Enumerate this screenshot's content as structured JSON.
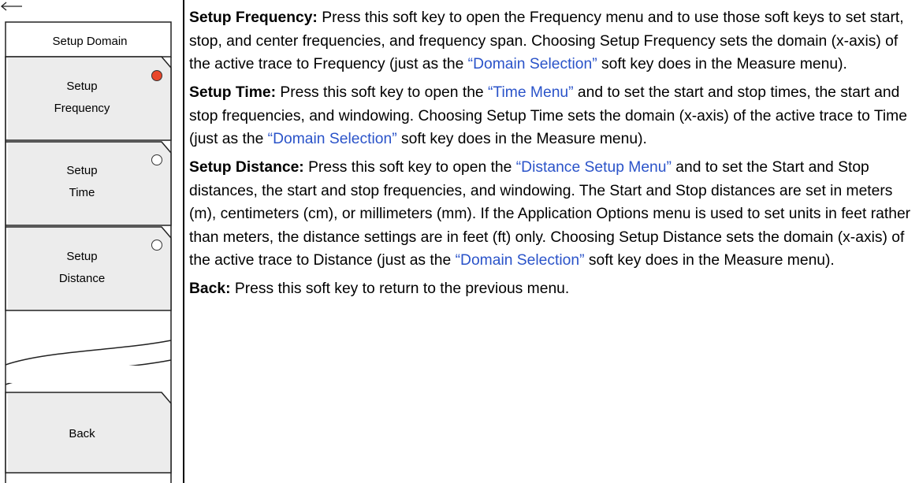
{
  "panel": {
    "title": "Setup Domain",
    "keys": [
      {
        "line1": "Setup",
        "line2": "Frequency",
        "active": true
      },
      {
        "line1": "Setup",
        "line2": "Time",
        "active": false
      },
      {
        "line1": "Setup",
        "line2": "Distance",
        "active": false
      }
    ],
    "back": "Back"
  },
  "colors": {
    "indicator_active": "#e8472b",
    "link": "#2a53c9"
  },
  "descriptions": {
    "freq": {
      "heading": "Setup Frequency:",
      "t1": " Press this soft key to open the Frequency menu and to use those soft keys to set start, stop, and center frequencies, and frequency span. Choosing Setup Frequency sets the domain (x-axis) of the active trace to Frequency (just as the ",
      "link1": "“Domain Selection”",
      "t2": " soft key does in the Measure menu)."
    },
    "time": {
      "heading": "Setup Time:",
      "t1": " Press this soft key to open the ",
      "link1": "“Time Menu”",
      "t2": " and to set the start and stop times, the start and stop frequencies, and windowing. Choosing Setup Time sets the domain (x-axis) of the active trace to Time (just as the ",
      "link2": "“Domain Selection”",
      "t3": " soft key does in the Measure menu)."
    },
    "distance": {
      "heading": "Setup Distance:",
      "t1": " Press this soft key to open the ",
      "link1": "“Distance Setup Menu”",
      "t2": " and to set the Start and Stop distances, the start and stop frequencies, and windowing. The Start and Stop distances are set in meters (m), centimeters (cm), or millimeters (mm). If the Application Options menu is used to set units in feet rather than meters, the distance settings are in feet (ft) only. Choosing Setup Distance sets the domain (x-axis) of the active trace to Distance (just as the ",
      "link2": "“Domain Selection”",
      "t3": " soft key does in the Measure menu)."
    },
    "back": {
      "heading": "Back:",
      "t1": " Press this soft key to return to the previous menu."
    }
  }
}
